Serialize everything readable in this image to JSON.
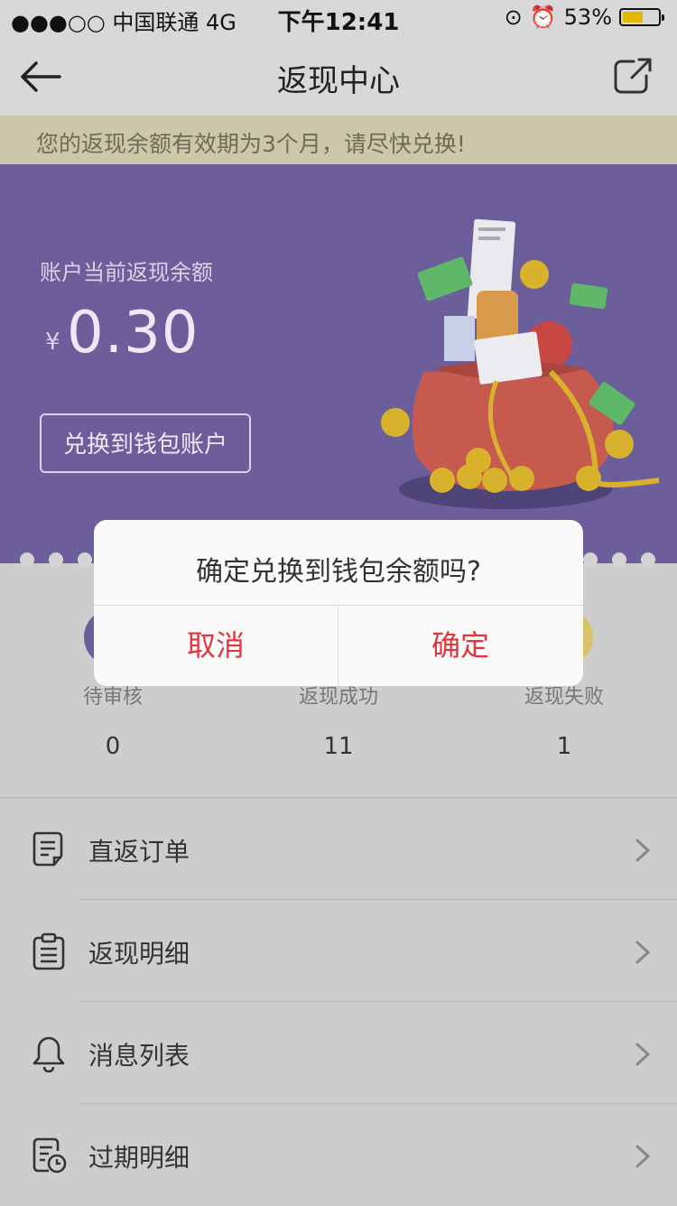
{
  "status_bar": {
    "carrier": "●●●○○ 中国联通  4G",
    "time": "下午12:41",
    "battery_text": "53%",
    "battery_level": 0.53
  },
  "nav": {
    "title": "返现中心",
    "back_icon": "back-arrow-icon",
    "share_icon": "share-icon"
  },
  "notice": {
    "text": "您的返现余额有效期为3个月，请尽快兑换!"
  },
  "balance": {
    "label": "账户当前返现余额",
    "currency": "¥",
    "amount": "0.30",
    "exchange_button": "兑换到钱包账户"
  },
  "stats": [
    {
      "label": "待审核",
      "value": "0",
      "color": "#6b5e9b"
    },
    {
      "label": "返现成功",
      "value": "11",
      "color": "#d9c26b"
    },
    {
      "label": "返现失败",
      "value": "1",
      "color": "#d9c26b"
    }
  ],
  "menu": [
    {
      "label": "直返订单",
      "icon": "order-list-icon"
    },
    {
      "label": "返现明细",
      "icon": "clipboard-icon"
    },
    {
      "label": "消息列表",
      "icon": "bell-icon"
    },
    {
      "label": "过期明细",
      "icon": "expired-clock-icon"
    }
  ],
  "dialog": {
    "message": "确定兑换到钱包余额吗?",
    "cancel": "取消",
    "confirm": "确定"
  },
  "colors": {
    "banner": "#6b5e9b",
    "accent_red": "#e0363f",
    "notice_bg": "#cbc8aa"
  }
}
